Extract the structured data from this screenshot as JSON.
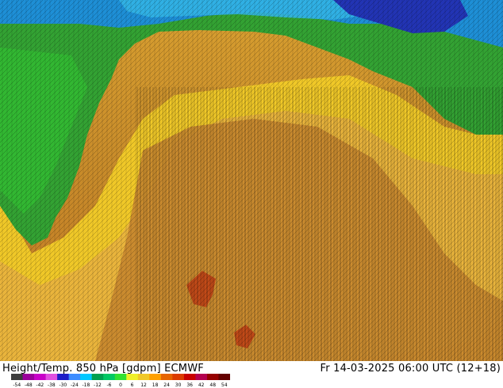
{
  "map": {
    "title_left": "Height/Temp. 850 hPa [gdpm] ECMWF",
    "title_right": "Fr 14-03-2025 06:00 UTC (12+18)"
  },
  "legend": {
    "ticks": [
      "-54",
      "-48",
      "-42",
      "-38",
      "-30",
      "-24",
      "-18",
      "-12",
      "-6",
      "0",
      "6",
      "12",
      "18",
      "24",
      "30",
      "36",
      "42",
      "48",
      "54"
    ],
    "colors": [
      "#3c3c3c",
      "#9b009b",
      "#c800c8",
      "#e050e0",
      "#1e1ec8",
      "#3c8cff",
      "#00c8ff",
      "#00a050",
      "#00c864",
      "#32e132",
      "#f0f028",
      "#f0c828",
      "#ffa000",
      "#e66400",
      "#dc3c00",
      "#c80000",
      "#b40050",
      "#960000",
      "#640000"
    ]
  }
}
